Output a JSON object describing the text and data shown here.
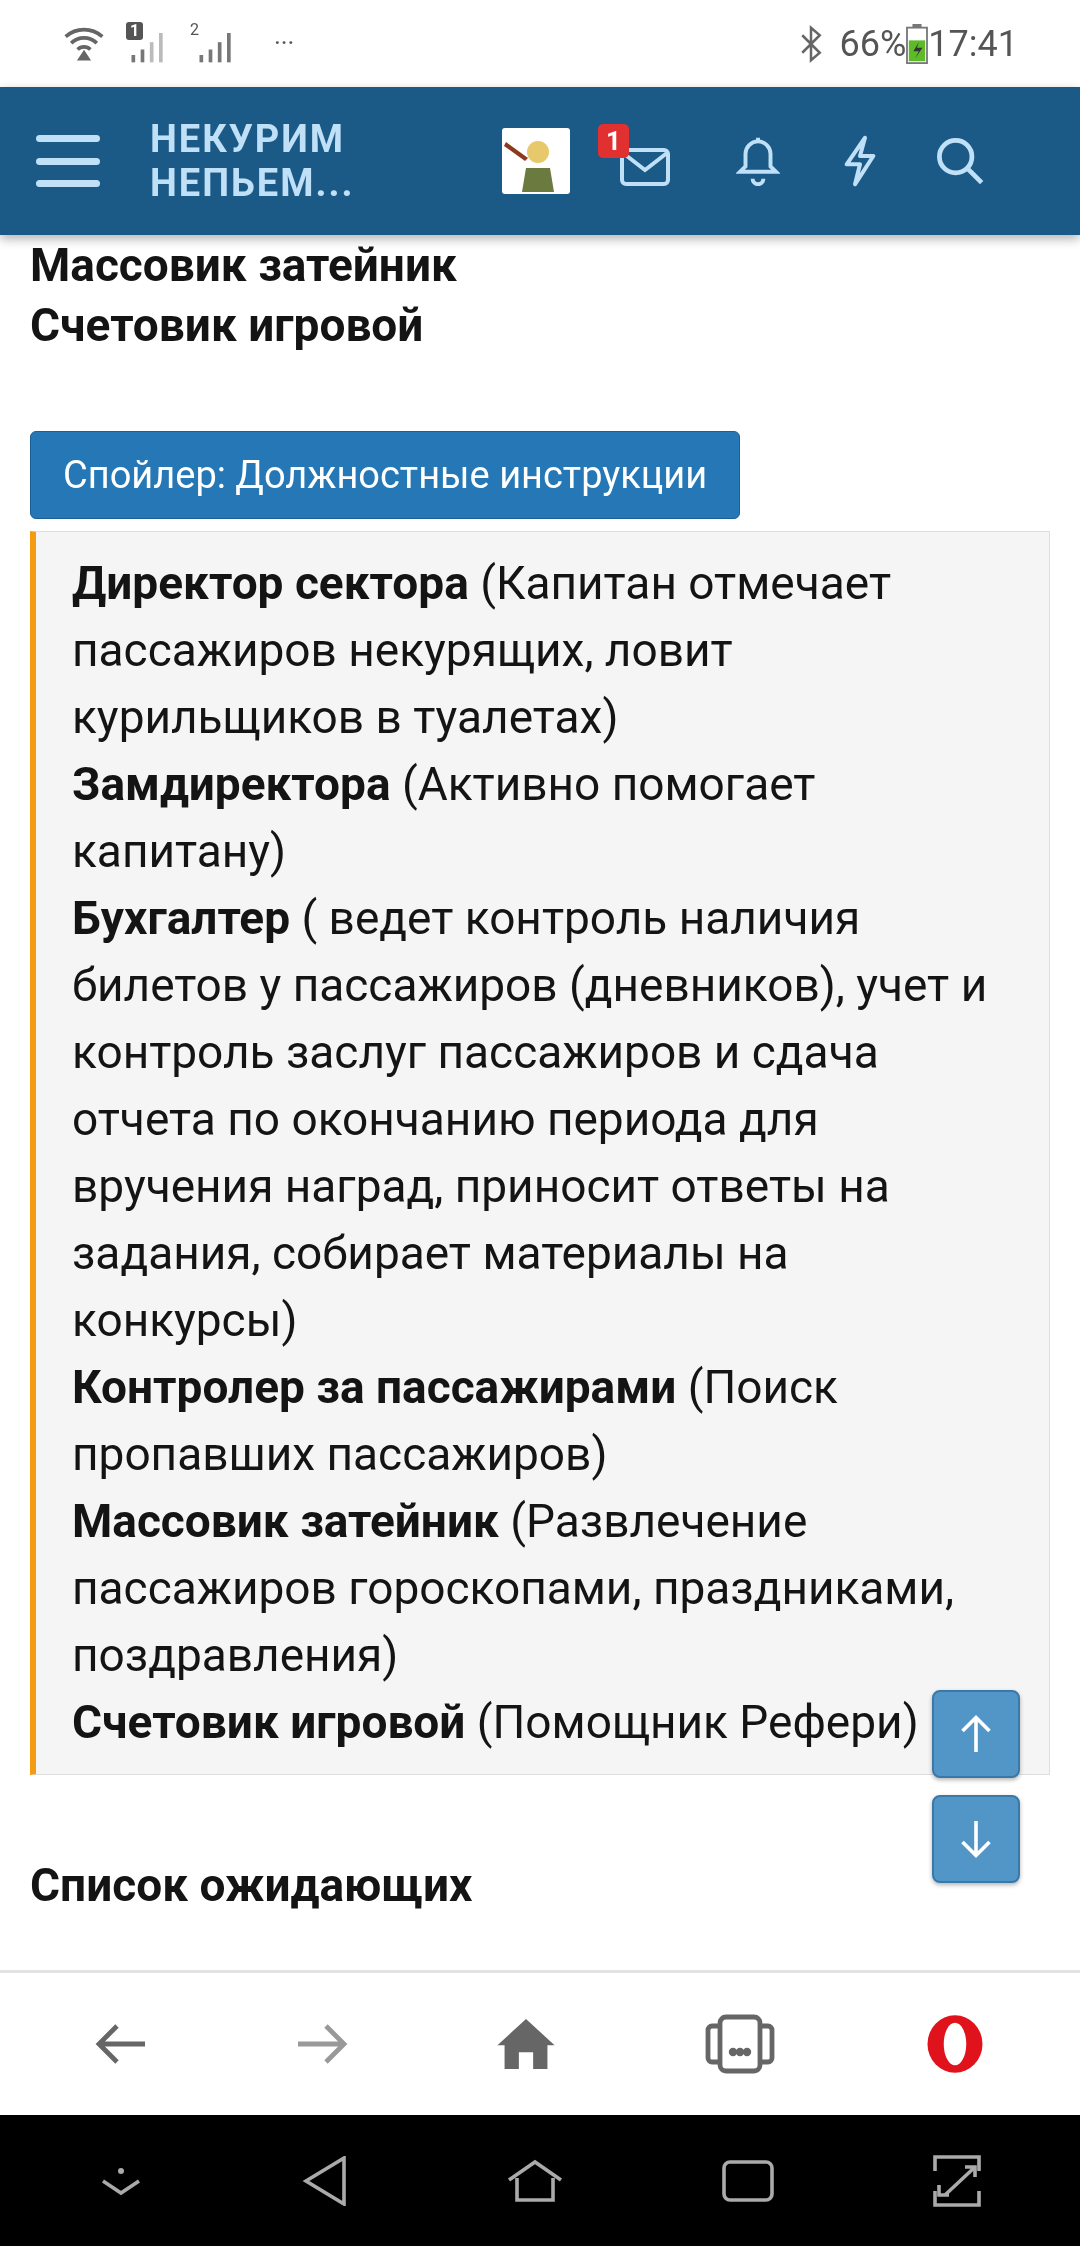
{
  "status_bar": {
    "sim_1": "1",
    "sim_2": "2",
    "more": "···",
    "battery_percent": "66%",
    "time": "17:41"
  },
  "header": {
    "logo_line_1": "НЕКУРИМ",
    "logo_line_2": "НЕПЬЕМ...",
    "messages_badge": "1"
  },
  "content": {
    "cut_heading": "Массовик затейник",
    "heading": "Счетовик игровой",
    "spoiler": {
      "label": "Спойлер: Должностные инструкции",
      "expanded": true,
      "entries": [
        "**Директор сектора** (Капитан отмечает пассажиров некурящих, ловит курильщиков в туалетах)",
        "**Замдиректора** (Активно помогает капитану)",
        "**Бухгалтер** ( ведет контроль наличия билетов у пассажиров (дневников), учет и контроль заслуг пассажиров и сдача отчета по окончанию периода для вручения наград, приносит ответы на задания, собирает материалы на конкурсы)",
        "**Контролер за пассажирами** (Поиск пропавших пассажиров)",
        "**Массовик затейник** (Развлечение пассажиров гороскопами, праздниками, поздравления)",
        "**Счетовик игровой** (Помощник Рефери)"
      ]
    },
    "next_heading": "Список ожидающих"
  }
}
